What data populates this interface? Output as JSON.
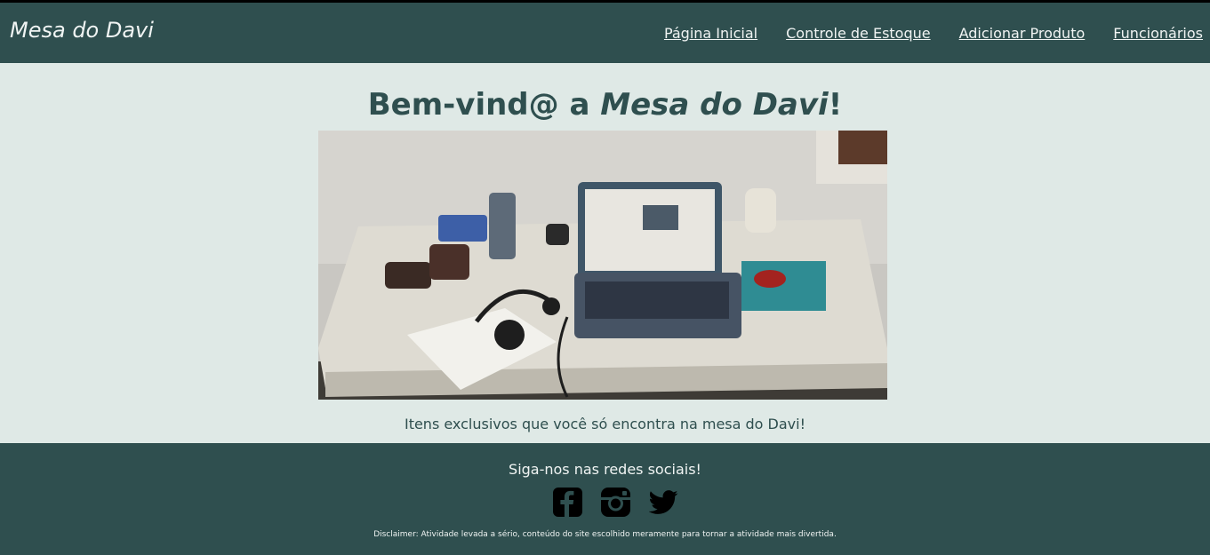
{
  "header": {
    "brand": "Mesa do Davi",
    "nav": [
      "Página Inicial",
      "Controle de Estoque",
      "Adicionar Produto",
      "Funcionários"
    ]
  },
  "main": {
    "heading_prefix": "Bem-vind@ a ",
    "heading_emphasis": "Mesa do Davi",
    "heading_suffix": "!",
    "caption": "Itens exclusivos que você só encontra na mesa do Davi!"
  },
  "footer": {
    "follow": "Siga-nos nas redes sociais!",
    "social_icons": [
      "facebook-icon",
      "instagram-icon",
      "twitter-icon"
    ],
    "disclaimer": "Disclaimer: Atividade levada a sério, conteúdo do site escolhido meramente para tornar a atividade mais divertida."
  },
  "colors": {
    "header_bg": "#2f4f4f",
    "page_bg": "#dfe9e6",
    "text": "#2f4f4f"
  }
}
